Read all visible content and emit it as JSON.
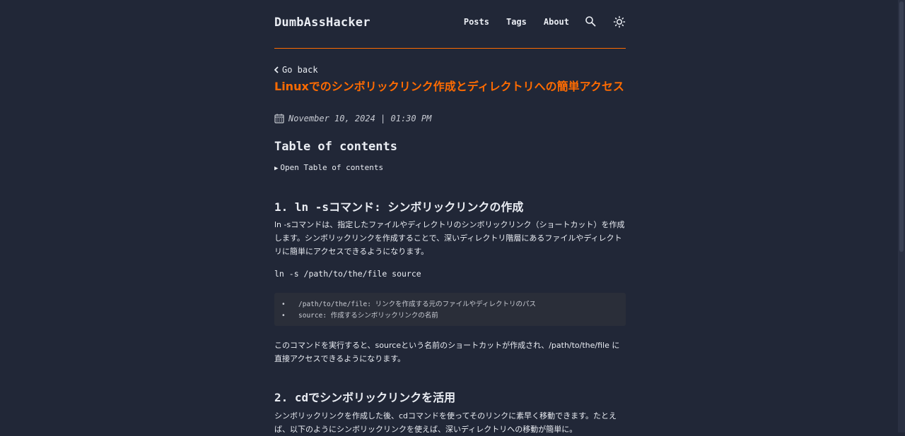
{
  "header": {
    "logo": "DumbAssHacker",
    "nav": [
      "Posts",
      "Tags",
      "About"
    ]
  },
  "post": {
    "back_label": "Go back",
    "title": "Linuxでのシンボリックリンク作成とディレクトリへの簡単アクセス",
    "date": "November 10, 2024 | 01:30 PM",
    "toc_heading": "Table of contents",
    "toc_summary": "Open Table of contents",
    "section1_heading": "1. ln -sコマンド: シンボリックリンクの作成",
    "section1_para": "ln -sコマンドは、指定したファイルやディレクトリのシンボリックリンク（ショートカット）を作成します。シンボリックリンクを作成することで、深いディレクトリ階層にあるファイルやディレクトリに簡単にアクセスできるようになります。",
    "section1_command": "ln -s /path/to/the/file source",
    "code_items": [
      "/path/to/the/file: リンクを作成する元のファイルやディレクトリのパス",
      "source: 作成するシンボリックリンクの名前"
    ],
    "section1_para2": "このコマンドを実行すると、sourceという名前のショートカットが作成され、/path/to/the/file に直接アクセスできるようになります。",
    "section2_heading": "2. cdでシンボリックリンクを活用",
    "section2_para": "シンボリックリンクを作成した後、cdコマンドを使ってそのリンクに素早く移動できます。たとえば、以下のようにシンボリックリンクを使えば、深いディレクトリへの移動が簡単に。"
  },
  "colors": {
    "background": "#212737",
    "accent": "#ff6b01",
    "text": "#eaedf3",
    "code_bg": "#2a2e39"
  }
}
